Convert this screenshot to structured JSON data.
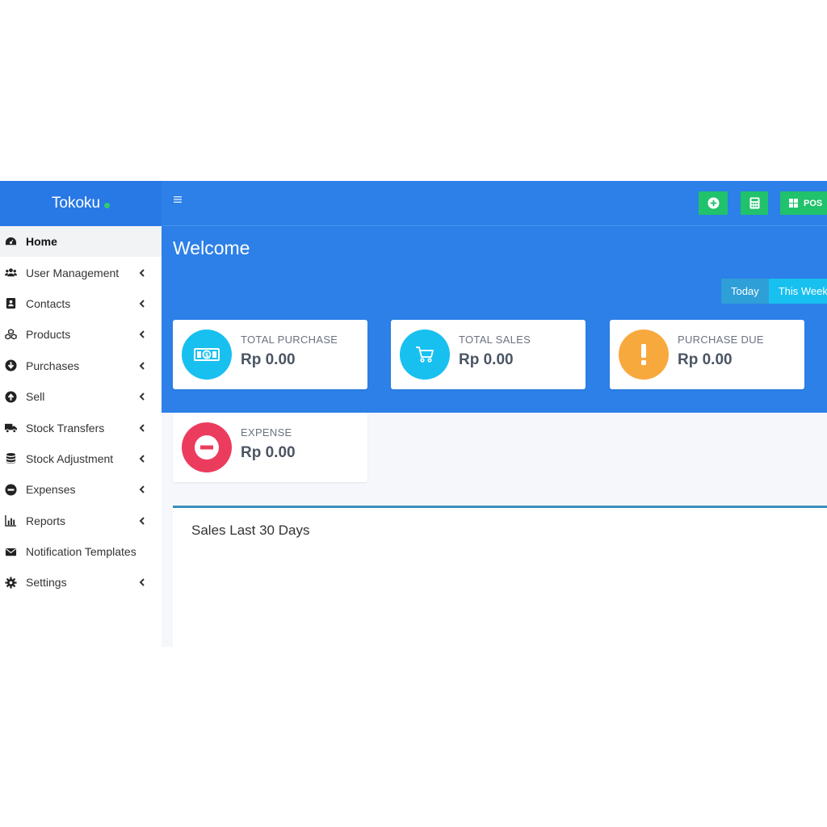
{
  "brand": {
    "name": "Tokoku",
    "status_color": "#2ecc71"
  },
  "colors": {
    "primary": "#2c80e8",
    "success": "#20c26b",
    "info": "#18c0f0",
    "warning": "#f8a93e",
    "danger": "#ec3c5e"
  },
  "sidebar": {
    "items": [
      {
        "label": "Home",
        "icon": "dashboard-icon",
        "active": true,
        "has_submenu": false
      },
      {
        "label": "User Management",
        "icon": "users-icon",
        "has_submenu": true
      },
      {
        "label": "Contacts",
        "icon": "address-book-icon",
        "has_submenu": true
      },
      {
        "label": "Products",
        "icon": "cubes-icon",
        "has_submenu": true
      },
      {
        "label": "Purchases",
        "icon": "arrow-circle-down-icon",
        "has_submenu": true
      },
      {
        "label": "Sell",
        "icon": "arrow-circle-up-icon",
        "has_submenu": true
      },
      {
        "label": "Stock Transfers",
        "icon": "truck-icon",
        "has_submenu": true
      },
      {
        "label": "Stock Adjustment",
        "icon": "database-icon",
        "has_submenu": true
      },
      {
        "label": "Expenses",
        "icon": "minus-circle-icon",
        "has_submenu": true
      },
      {
        "label": "Reports",
        "icon": "bar-chart-icon",
        "has_submenu": true
      },
      {
        "label": "Notification Templates",
        "icon": "envelope-icon",
        "has_submenu": false
      },
      {
        "label": "Settings",
        "icon": "cog-icon",
        "has_submenu": true
      }
    ]
  },
  "topbar": {
    "pos_label": "POS"
  },
  "main": {
    "welcome": "Welcome",
    "filters": {
      "today": "Today",
      "this_week": "This Week"
    },
    "cards": [
      {
        "label": "TOTAL PURCHASE",
        "value": "Rp 0.00",
        "icon": "money-icon",
        "color": "#18c0f0"
      },
      {
        "label": "TOTAL SALES",
        "value": "Rp 0.00",
        "icon": "cart-icon",
        "color": "#18c0f0"
      },
      {
        "label": "PURCHASE DUE",
        "value": "Rp 0.00",
        "icon": "exclamation-icon",
        "color": "#f8a93e"
      },
      {
        "label": "EXPENSE",
        "value": "Rp 0.00",
        "icon": "minus-circle-icon",
        "color": "#ec3c5e"
      }
    ],
    "sales_chart_title": "Sales Last 30 Days"
  }
}
